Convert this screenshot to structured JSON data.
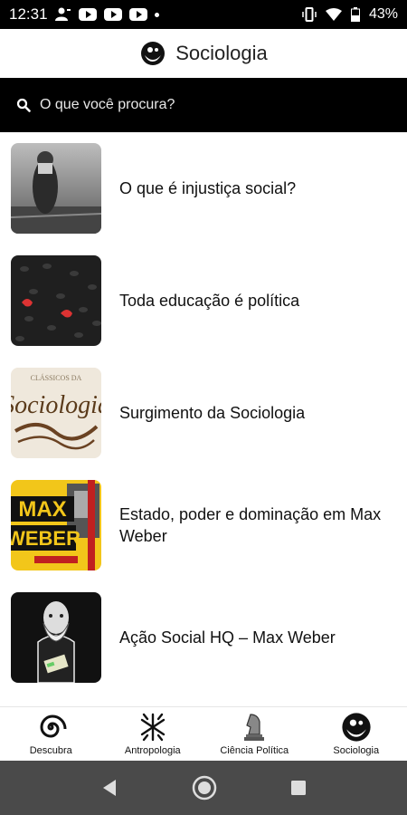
{
  "status_bar": {
    "time": "12:31",
    "battery": "43%"
  },
  "header": {
    "title": "Sociologia"
  },
  "search": {
    "placeholder": "O que você procura?"
  },
  "articles": [
    {
      "title": "O que é injustiça social?"
    },
    {
      "title": "Toda educação é política"
    },
    {
      "title": "Surgimento da Sociologia",
      "thumb_text_top": "CLÁSSICOS DA",
      "thumb_text_main": "Sociologia"
    },
    {
      "title": "Estado, poder e dominação em Max Weber",
      "thumb_text_1": "MAX",
      "thumb_text_2": "WEBER"
    },
    {
      "title": "Ação Social HQ – Max Weber"
    }
  ],
  "bottom_nav": [
    {
      "label": "Descubra",
      "icon": "spiral-icon"
    },
    {
      "label": "Antropologia",
      "icon": "figures-icon"
    },
    {
      "label": "Ciência Política",
      "icon": "chess-knight-icon"
    },
    {
      "label": "Sociologia",
      "icon": "bearded-face-icon"
    }
  ],
  "colors": {
    "bar_black": "#000000",
    "system_nav": "#4a4a4a"
  }
}
